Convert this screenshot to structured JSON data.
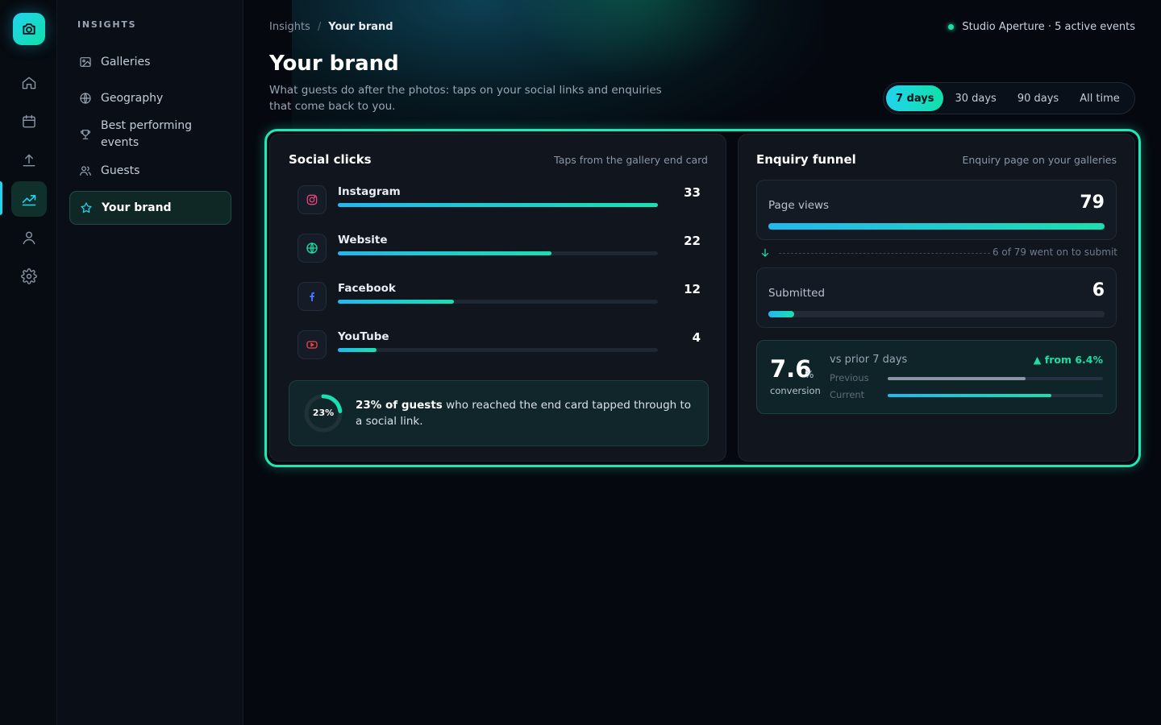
{
  "rail": {
    "items": [
      {
        "name": "home",
        "icon": "home-icon"
      },
      {
        "name": "calendar",
        "icon": "calendar-icon"
      },
      {
        "name": "upload",
        "icon": "upload-icon"
      },
      {
        "name": "insights",
        "icon": "trending-up-icon",
        "active": true
      },
      {
        "name": "account",
        "icon": "user-icon"
      },
      {
        "name": "settings",
        "icon": "gear-icon"
      }
    ]
  },
  "sidebar": {
    "heading": "INSIGHTS",
    "items": [
      {
        "label": "Galleries",
        "icon": "image-icon"
      },
      {
        "label": "Geography",
        "icon": "globe-icon"
      },
      {
        "label": "Best performing events",
        "icon": "trophy-icon"
      },
      {
        "label": "Guests",
        "icon": "users-icon"
      },
      {
        "label": "Your brand",
        "icon": "star-icon",
        "active": true
      }
    ]
  },
  "header": {
    "breadcrumb": [
      "Insights",
      "/",
      "Your brand"
    ],
    "status": "Studio Aperture · 5 active events",
    "title": "Your brand",
    "subtitle": "What guests do after the photos: taps on your social links and enquiries that come back to you.",
    "ranges": [
      "7 days",
      "30 days",
      "90 days",
      "All time"
    ],
    "selected_range": "7 days"
  },
  "social": {
    "title": "Social clicks",
    "note": "Taps from the gallery end card",
    "max": 33,
    "items": [
      {
        "label": "Instagram",
        "value": 33,
        "icon": "instagram-icon",
        "color": "#e0457b"
      },
      {
        "label": "Website",
        "value": 22,
        "icon": "globe-icon",
        "color": "#19e0a0"
      },
      {
        "label": "Facebook",
        "value": 12,
        "icon": "facebook-icon",
        "color": "#3b7bff"
      },
      {
        "label": "YouTube",
        "value": 4,
        "icon": "youtube-icon",
        "color": "#ef4444"
      }
    ],
    "callout": {
      "donut_label": "23%",
      "donut_value": 0.23,
      "bold": "23% of guests",
      "text": " who reached the end card tapped through to a social link."
    }
  },
  "funnel": {
    "title": "Enquiry funnel",
    "note": "Enquiry page on your galleries",
    "page_views": {
      "label": "Page views",
      "value": "79",
      "fraction": 1.0
    },
    "flow_text": "6 of 79 went on to submit",
    "submitted": {
      "label": "Submitted",
      "value": "6",
      "fraction": 0.076
    },
    "conversion": {
      "value": "7.6",
      "unit": "%",
      "label": "conversion",
      "compare": "vs prior 7 days",
      "change": "▲ from 6.4%",
      "previous_label": "Previous",
      "current_label": "Current",
      "previous_fraction": 0.64,
      "current_fraction": 0.76
    }
  },
  "colors": {
    "accent": "#22d3ee",
    "accent_green": "#1de9b6",
    "background": "#05080f",
    "card": "#10151e"
  }
}
